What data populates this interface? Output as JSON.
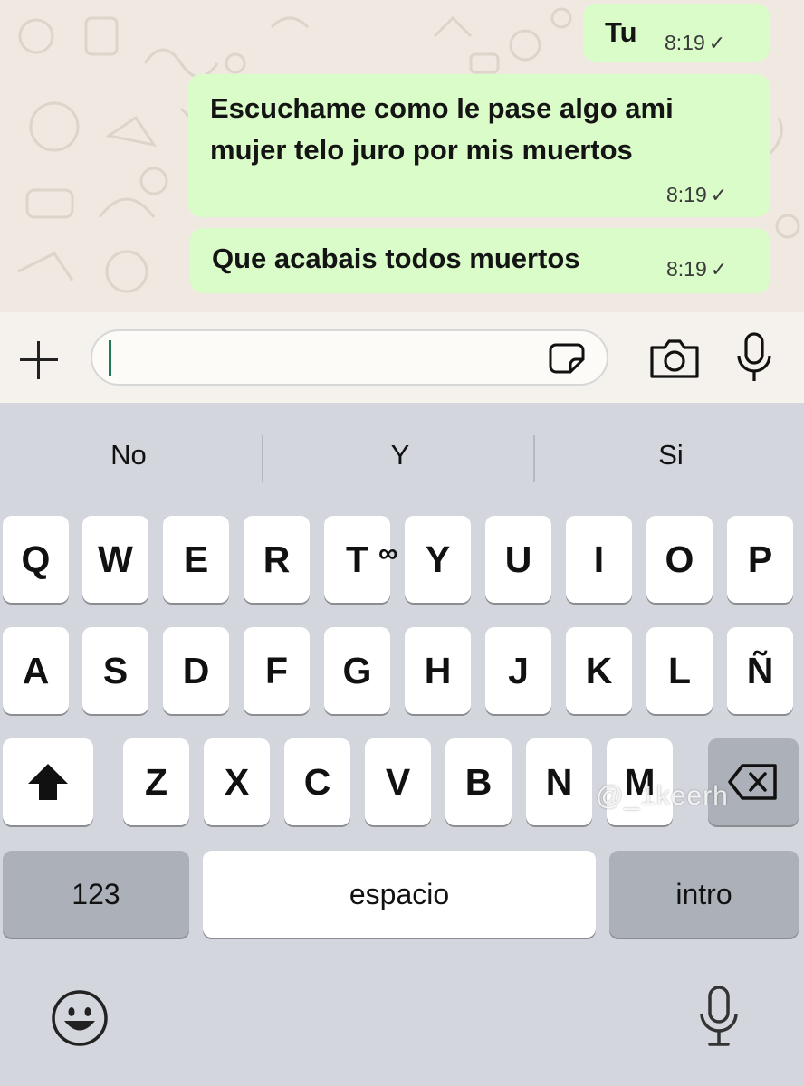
{
  "chat": {
    "messages": [
      {
        "text": "Tu",
        "time": "8:19",
        "status": "✓"
      },
      {
        "text_line1": "Escuchame como le pase algo ami",
        "text_line2": "mujer telo juro por mis muertos",
        "time": "8:19",
        "status": "✓"
      },
      {
        "text": "Que acabais todos muertos",
        "time": "8:19",
        "status": "✓"
      }
    ]
  },
  "input_bar": {
    "attach_icon": "plus-icon",
    "message_value": "",
    "sticker_icon": "sticker-icon",
    "camera_icon": "camera-icon",
    "mic_icon": "microphone-icon",
    "caret_color": "#1c7a5a"
  },
  "keyboard": {
    "suggestions": [
      "No",
      "Y",
      "Si"
    ],
    "row1": [
      "Q",
      "W",
      "E",
      "R",
      "T",
      "Y",
      "U",
      "I",
      "O",
      "P"
    ],
    "row2": [
      "A",
      "S",
      "D",
      "F",
      "G",
      "H",
      "J",
      "K",
      "L",
      "Ñ"
    ],
    "row3": [
      "Z",
      "X",
      "C",
      "V",
      "B",
      "N",
      "M"
    ],
    "shift_icon": "shift-arrow-icon",
    "delete_icon": "backspace-icon",
    "numbers_label": "123",
    "space_label": "espacio",
    "return_label": "intro",
    "emoji_icon": "emoji-icon",
    "dictation_icon": "microphone-icon",
    "overlay_glyph": "∞",
    "watermark": "@_1keerh"
  },
  "colors": {
    "bubble": "#d9fcc8",
    "chat_bg": "#efe9e1",
    "keyboard_bg": "#d4d6dd",
    "key": "#ffffff",
    "special_key": "#acb0b9"
  }
}
